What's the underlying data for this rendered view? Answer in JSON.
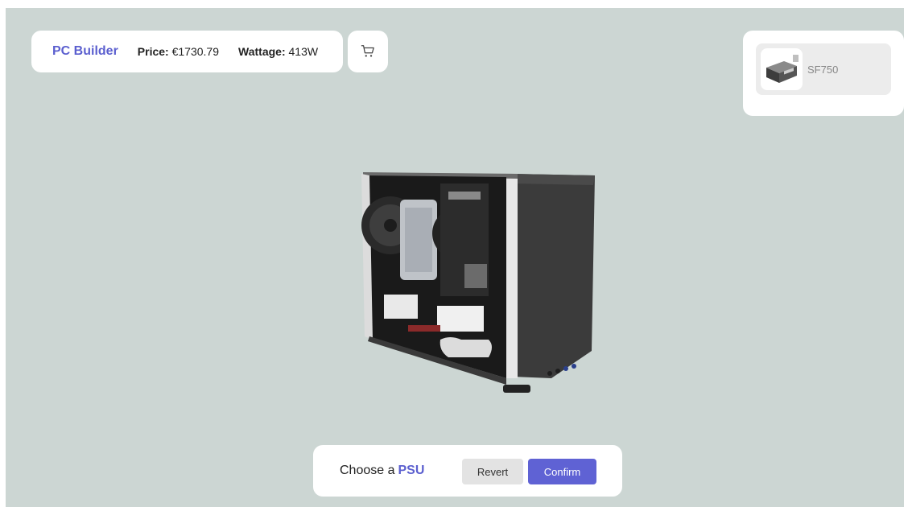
{
  "header": {
    "brand": "PC Builder",
    "price_label": "Price:",
    "price_value": "€1730.79",
    "wattage_label": "Wattage:",
    "wattage_value": "413W",
    "cart_icon": "cart-icon"
  },
  "parts": [
    {
      "label": "SF750",
      "icon": "psu-icon"
    }
  ],
  "scene": {
    "subject": "pc-case-model"
  },
  "footer": {
    "prompt_prefix": "Choose a",
    "prompt_accent": "PSU",
    "revert_label": "Revert",
    "confirm_label": "Confirm"
  },
  "colors": {
    "accent": "#5b5fcf",
    "background": "#ccd6d3",
    "panel": "#ffffff"
  }
}
